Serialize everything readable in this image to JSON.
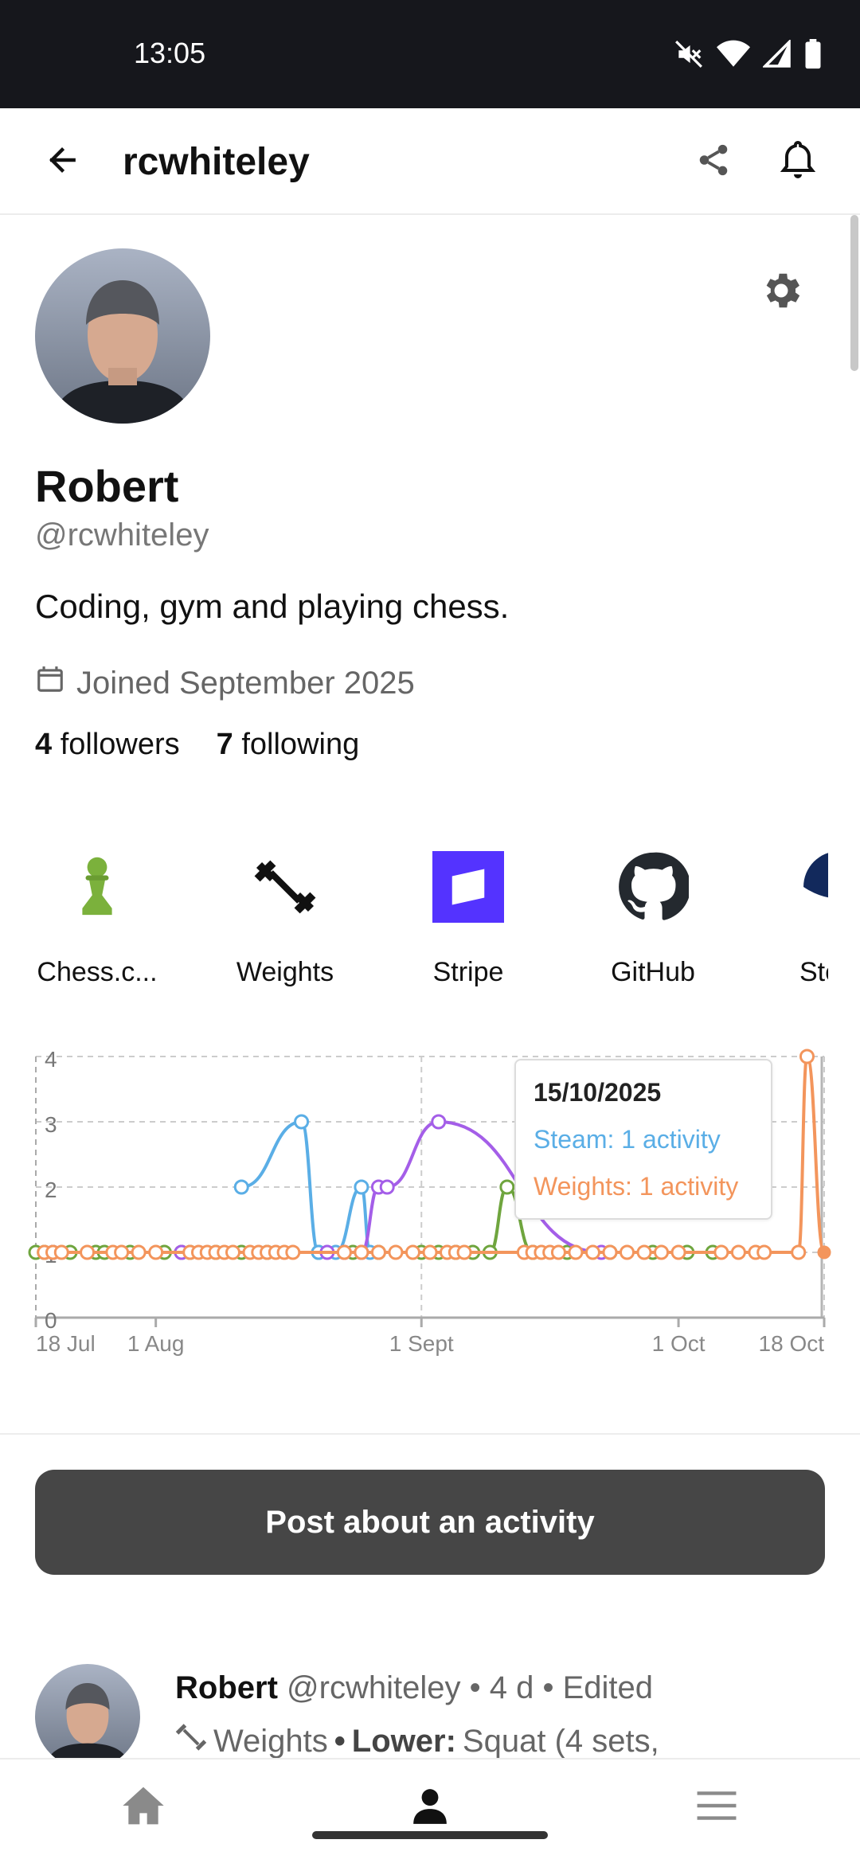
{
  "status_bar": {
    "time": "13:05"
  },
  "app_bar": {
    "title": "rcwhiteley"
  },
  "profile": {
    "name": "Robert",
    "handle": "@rcwhiteley",
    "bio": "Coding, gym and playing chess.",
    "joined": "Joined September 2025",
    "followers_count": "4",
    "followers_label": "followers",
    "following_count": "7",
    "following_label": "following"
  },
  "integrations": [
    {
      "label": "Chess.c...",
      "icon": "chess-pawn-icon"
    },
    {
      "label": "Weights",
      "icon": "dumbbell-icon"
    },
    {
      "label": "Stripe",
      "icon": "stripe-icon"
    },
    {
      "label": "GitHub",
      "icon": "github-icon"
    },
    {
      "label": "Ste",
      "icon": "steam-icon"
    }
  ],
  "tooltip": {
    "date": "15/10/2025",
    "rows": [
      {
        "text": "Steam: 1 activity",
        "color": "#5aaee6"
      },
      {
        "text": "Weights: 1 activity",
        "color": "#f3955c"
      }
    ]
  },
  "chart_data": {
    "type": "line",
    "x_start": "2025-07-18",
    "x_end": "2025-10-18",
    "x_ticks": [
      "18 Jul",
      "1 Aug",
      "1 Sept",
      "1 Oct",
      "18 Oct"
    ],
    "y_ticks": [
      "0",
      "1",
      "2",
      "3",
      "4"
    ],
    "ylim": [
      0,
      4
    ],
    "grid": true,
    "crosshair_x": "2025-10-18",
    "series": [
      {
        "color": "#6fa53e",
        "points": [
          [
            "2025-07-18",
            1
          ],
          [
            "2025-07-19",
            1
          ],
          [
            "2025-07-20",
            1
          ],
          [
            "2025-07-22",
            1
          ],
          [
            "2025-07-25",
            1
          ],
          [
            "2025-07-26",
            1
          ],
          [
            "2025-07-29",
            1
          ],
          [
            "2025-08-02",
            1
          ],
          [
            "2025-08-04",
            1
          ],
          [
            "2025-08-05",
            1
          ],
          [
            "2025-08-08",
            1
          ],
          [
            "2025-08-11",
            1
          ],
          [
            "2025-08-14",
            1
          ],
          [
            "2025-08-20",
            1
          ],
          [
            "2025-08-24",
            1
          ],
          [
            "2025-08-27",
            1
          ],
          [
            "2025-09-01",
            1
          ],
          [
            "2025-09-03",
            1
          ],
          [
            "2025-09-05",
            1
          ],
          [
            "2025-09-07",
            1
          ],
          [
            "2025-09-09",
            1
          ],
          [
            "2025-09-11",
            2
          ],
          [
            "2025-09-14",
            1
          ],
          [
            "2025-09-18",
            1
          ],
          [
            "2025-09-23",
            1
          ],
          [
            "2025-09-28",
            1
          ],
          [
            "2025-10-02",
            1
          ],
          [
            "2025-10-05",
            1
          ]
        ]
      },
      {
        "color": "#5aaee6",
        "points": [
          [
            "2025-08-11",
            2
          ],
          [
            "2025-08-18",
            3
          ],
          [
            "2025-08-20",
            1
          ],
          [
            "2025-08-22",
            1
          ],
          [
            "2025-08-25",
            2
          ],
          [
            "2025-08-26",
            1
          ]
        ]
      },
      {
        "color": "#a45ee8",
        "points": [
          [
            "2025-07-20",
            1
          ],
          [
            "2025-08-04",
            1
          ],
          [
            "2025-08-21",
            1
          ],
          [
            "2025-08-23",
            1
          ],
          [
            "2025-08-25",
            1
          ],
          [
            "2025-08-27",
            2
          ],
          [
            "2025-08-28",
            2
          ],
          [
            "2025-09-03",
            3
          ],
          [
            "2025-09-22",
            1
          ]
        ]
      },
      {
        "color": "#f3955c",
        "points": [
          [
            "2025-07-19",
            1
          ],
          [
            "2025-07-20",
            1
          ],
          [
            "2025-07-21",
            1
          ],
          [
            "2025-07-24",
            1
          ],
          [
            "2025-07-27",
            1
          ],
          [
            "2025-07-28",
            1
          ],
          [
            "2025-07-30",
            1
          ],
          [
            "2025-08-01",
            1
          ],
          [
            "2025-08-05",
            1
          ],
          [
            "2025-08-06",
            1
          ],
          [
            "2025-08-07",
            1
          ],
          [
            "2025-08-08",
            1
          ],
          [
            "2025-08-09",
            1
          ],
          [
            "2025-08-10",
            1
          ],
          [
            "2025-08-12",
            1
          ],
          [
            "2025-08-13",
            1
          ],
          [
            "2025-08-14",
            1
          ],
          [
            "2025-08-15",
            1
          ],
          [
            "2025-08-16",
            1
          ],
          [
            "2025-08-17",
            1
          ],
          [
            "2025-08-23",
            1
          ],
          [
            "2025-08-25",
            1
          ],
          [
            "2025-08-27",
            1
          ],
          [
            "2025-08-29",
            1
          ],
          [
            "2025-08-31",
            1
          ],
          [
            "2025-09-02",
            1
          ],
          [
            "2025-09-04",
            1
          ],
          [
            "2025-09-05",
            1
          ],
          [
            "2025-09-06",
            1
          ],
          [
            "2025-09-13",
            1
          ],
          [
            "2025-09-14",
            1
          ],
          [
            "2025-09-15",
            1
          ],
          [
            "2025-09-16",
            1
          ],
          [
            "2025-09-17",
            1
          ],
          [
            "2025-09-19",
            1
          ],
          [
            "2025-09-21",
            1
          ],
          [
            "2025-09-23",
            1
          ],
          [
            "2025-09-25",
            1
          ],
          [
            "2025-09-27",
            1
          ],
          [
            "2025-09-29",
            1
          ],
          [
            "2025-10-01",
            1
          ],
          [
            "2025-10-06",
            1
          ],
          [
            "2025-10-08",
            1
          ],
          [
            "2025-10-10",
            1
          ],
          [
            "2025-10-11",
            1
          ],
          [
            "2025-10-15",
            1
          ],
          [
            "2025-10-16",
            4
          ],
          [
            "2025-10-18",
            1
          ]
        ]
      }
    ]
  },
  "post_button": {
    "label": "Post about an activity"
  },
  "feed": {
    "item": {
      "name": "Robert",
      "handle": "@rcwhiteley",
      "sep1": "•",
      "age": "4 d",
      "sep2": "•",
      "edited": "Edited",
      "app": "Weights",
      "sep3": "•",
      "category": "Lower:",
      "summary": "Squat (4 sets,"
    }
  },
  "nav": [
    "Home",
    "Profile",
    "Menu"
  ]
}
